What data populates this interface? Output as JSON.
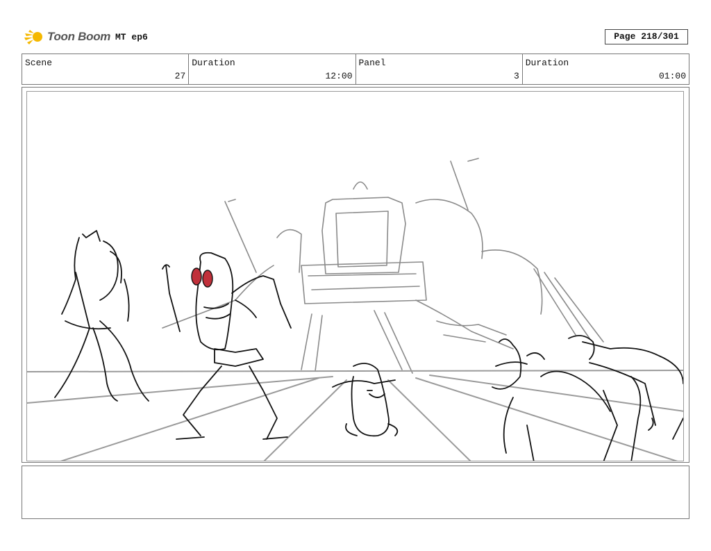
{
  "header": {
    "brand": "Toon Boom",
    "episode": "MT ep6",
    "page_label": "Page 218/301"
  },
  "info": {
    "scene_label": "Scene",
    "scene_value": "27",
    "duration_label": "Duration",
    "duration_value": "12:00",
    "panel_label": "Panel",
    "panel_value": "3",
    "panel_duration_label": "Duration",
    "panel_duration_value": "01:00"
  },
  "colors": {
    "logo_accent": "#f5b800",
    "eye_red": "#c0303a"
  }
}
